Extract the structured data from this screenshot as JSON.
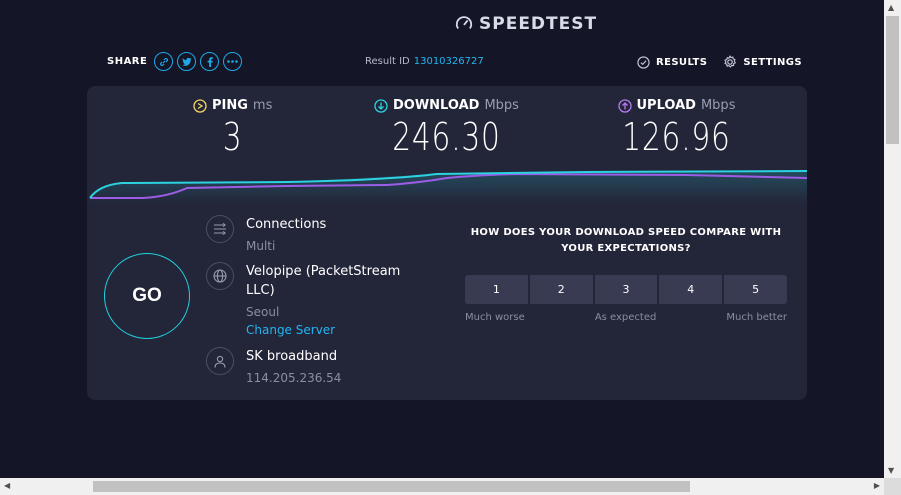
{
  "logo": {
    "text": "SPEEDTEST"
  },
  "share": {
    "label": "SHARE"
  },
  "result": {
    "label": "Result ID",
    "id": "13010326727"
  },
  "nav": {
    "results": "RESULTS",
    "settings": "SETTINGS"
  },
  "metrics": {
    "ping": {
      "label": "PING",
      "unit": "ms",
      "value": "3"
    },
    "download": {
      "label": "DOWNLOAD",
      "unit": "Mbps",
      "value": "246.30"
    },
    "upload": {
      "label": "UPLOAD",
      "unit": "Mbps",
      "value": "126.96"
    }
  },
  "go": {
    "label": "GO"
  },
  "connections": {
    "title": "Connections",
    "value": "Multi"
  },
  "server": {
    "name": "Velopipe (PacketStream LLC)",
    "city": "Seoul",
    "change_link": "Change Server"
  },
  "isp": {
    "name": "SK broadband",
    "ip": "114.205.236.54"
  },
  "survey": {
    "question": "HOW DOES YOUR DOWNLOAD SPEED COMPARE WITH YOUR EXPECTATIONS?",
    "options": [
      "1",
      "2",
      "3",
      "4",
      "5"
    ],
    "labels": {
      "low": "Much worse",
      "mid": "As expected",
      "high": "Much better"
    }
  },
  "colors": {
    "accent": "#1ea9e8",
    "download_line": "#2ad3df",
    "upload_line": "#9b5de5",
    "background": "#141526",
    "panel": "#232539"
  }
}
